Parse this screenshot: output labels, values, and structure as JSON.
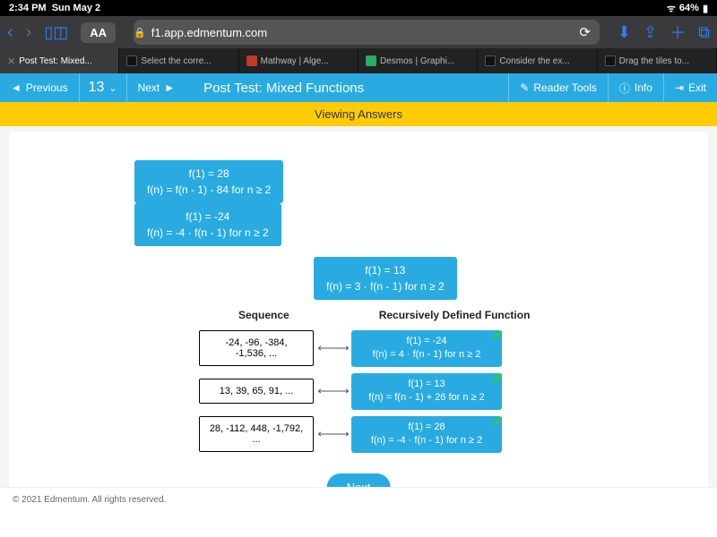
{
  "status": {
    "time": "2:34 PM",
    "date": "Sun May 2",
    "battery": "64%",
    "signal": "ᯤ ⊕"
  },
  "browser": {
    "aa": "AA",
    "url": "f1.app.edmentum.com",
    "tabs": [
      {
        "label": "Post Test: Mixed...",
        "active": true
      },
      {
        "label": "Select the corre..."
      },
      {
        "label": "Mathway | Alge..."
      },
      {
        "label": "Desmos | Graphi..."
      },
      {
        "label": "Consider the ex..."
      },
      {
        "label": "Drag the tiles to..."
      }
    ]
  },
  "appbar": {
    "prev": "Previous",
    "qnum": "13",
    "next": "Next",
    "title": "Post Test: Mixed Functions",
    "reader": "Reader Tools",
    "info": "Info",
    "exit": "Exit"
  },
  "viewing": "Viewing Answers",
  "options": [
    {
      "l1": "f(1) = 28",
      "l2": "f(n) = f(n - 1) - 84 for n ≥ 2"
    },
    {
      "l1": "f(1) = -24",
      "l2": "f(n) = -4 · f(n - 1) for n ≥ 2"
    },
    {
      "l1": "f(1) = 13",
      "l2": "f(n) = 3 · f(n - 1) for n ≥ 2"
    }
  ],
  "headers": {
    "left": "Sequence",
    "right": "Recursively Defined Function"
  },
  "matches": [
    {
      "seq": "-24, -96, -384, -1,536, ...",
      "a1": "f(1) = -24",
      "a2": "f(n) = 4 · f(n - 1) for n ≥ 2"
    },
    {
      "seq": "13, 39, 65, 91, ...",
      "a1": "f(1) = 13",
      "a2": "f(n) = f(n - 1) + 26 for n ≥ 2"
    },
    {
      "seq": "28, -112, 448, -1,792, ...",
      "a1": "f(1) = 28",
      "a2": "f(n) = -4 · f(n - 1) for n ≥ 2"
    }
  ],
  "nextBtn": "Next",
  "footer": "© 2021 Edmentum. All rights reserved."
}
